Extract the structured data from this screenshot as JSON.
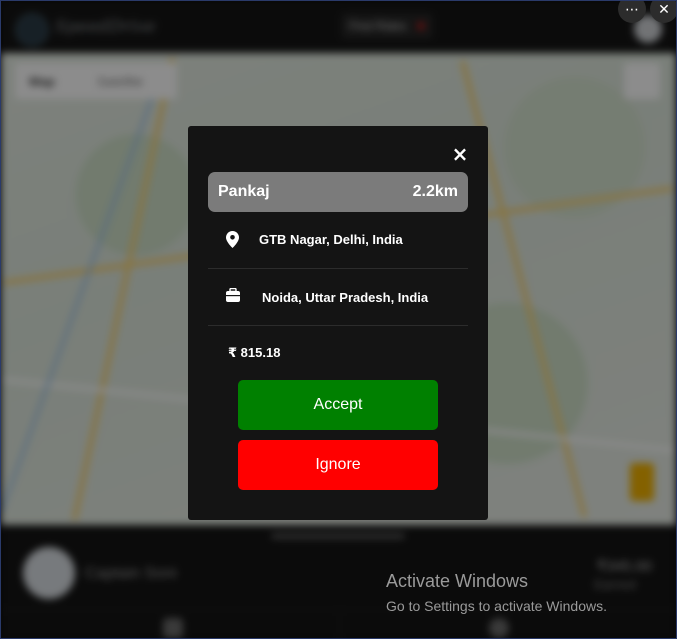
{
  "app": {
    "name": "SpeedDrive",
    "status_label": "Find Rides",
    "bottom": {
      "driver_name": "Captain Soni",
      "earnings": "₹345.00",
      "earnings_label": "Earned"
    },
    "map_tabs": [
      "Map",
      "Satellite"
    ]
  },
  "modal": {
    "close_symbol": "×",
    "rider_name": "Pankaj",
    "distance": "2.2km",
    "pickup": "GTB Nagar, Delhi, India",
    "drop": "Noida, Uttar Pradesh, India",
    "fare": "₹ 815.18",
    "accept_label": "Accept",
    "ignore_label": "Ignore"
  },
  "window_controls": {
    "more": "⋯",
    "close": "✕"
  },
  "watermark": {
    "title": "Activate Windows",
    "subtitle": "Go to Settings to activate Windows."
  },
  "colors": {
    "accept": "#008000",
    "ignore": "#ff0000",
    "modal_bg": "#141414",
    "rider_bar": "#7b7b7b"
  },
  "icons": {
    "pickup": "map-pin-icon",
    "drop": "briefcase-icon",
    "close": "close-icon"
  }
}
